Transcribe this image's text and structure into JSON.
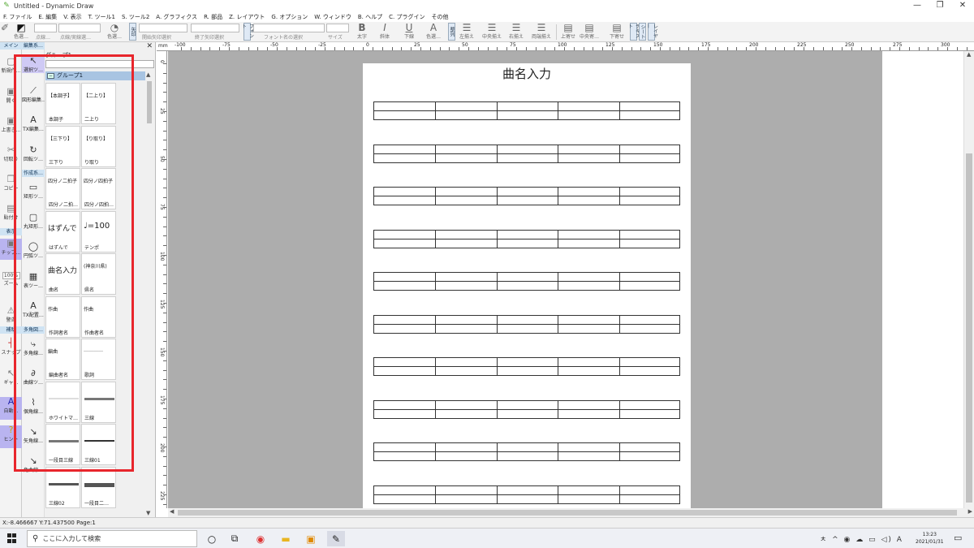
{
  "window": {
    "title": "Untitled - Dynamic Draw",
    "min": "—",
    "max": "❐",
    "close": "✕"
  },
  "menu": [
    "F. ファイル",
    "E. 編集",
    "V. 表示",
    "T. ツール1",
    "S. ツール2",
    "A. グラフィクス",
    "R. 部品",
    "Z. レイアウト",
    "G. オプション",
    "W. ウィンドウ",
    "B. ヘルプ",
    "C. プラグイン",
    "その他"
  ],
  "toolbar": {
    "color_label1": "色選…",
    "linetype_label": "点線…",
    "dash_label": "点線/実線選…",
    "color_label2": "色選…",
    "arrow_tab": "矢印",
    "arrow_start": "開始矢印選択",
    "arrow_end": "終了矢印選択",
    "font_tab": "フォント",
    "font_label": "フォント名の選択",
    "size_label": "サイズ",
    "bold": "太字",
    "italic": "斜体",
    "underline": "下線",
    "fontcolor": "色選…",
    "align_tab": "整列",
    "align_left": "左揃え",
    "align_center": "中央揃え",
    "align_right": "右揃え",
    "align_justify": "両端揃え",
    "valign_top": "上寄せ",
    "valign_middle": "中央寄…",
    "valign_bottom": "下寄せ",
    "text_tab": "テキスト",
    "sheet_tab": "シート",
    "layer_tab": "レイヤー"
  },
  "left_strip": {
    "tab_main": "メイン",
    "new": "新規作…",
    "open": "開く",
    "save": "上書き…",
    "cut": "切取り",
    "copy": "コピー",
    "paste": "貼付け",
    "tab_view": "表示",
    "chip": "チップ…",
    "zoom_value": "100%",
    "zoom": "ズーム",
    "warning": "警告",
    "tab_assist": "補助",
    "snap": "スナップ",
    "grip": "ギャ…",
    "auto": "自動…",
    "hint": "ヒント"
  },
  "tools": {
    "tab_edit": "編集系…",
    "select": "選択ツ…",
    "shape_edit": "図形編集…",
    "tx_edit": "TX編集…",
    "rotate": "回転ツ…",
    "tab_create": "作成系…",
    "rect": "矩形ツ…",
    "roundrect": "丸矩形…",
    "ellipse": "円弧ツ…",
    "table": "表ツー…",
    "tx_place": "TX配置…",
    "tab_polygon": "多角図…",
    "polygon": "多角線…",
    "curve": "曲線ツ…",
    "freeline": "個角線…",
    "arrowline": "矢角線…",
    "corner": "角曲線…"
  },
  "parts": {
    "header_tab": "グループ1",
    "group": "グループ1",
    "items": [
      {
        "preview": "【本調子】",
        "caption": "本調子"
      },
      {
        "preview": "【二上り】",
        "caption": "二上り"
      },
      {
        "preview": "【三下り】",
        "caption": "三下り"
      },
      {
        "preview": "【り取り】",
        "caption": "り取り"
      },
      {
        "preview": "四分ノ二拍子",
        "caption": "四分ノ二拍…"
      },
      {
        "preview": "四分ノ四拍子",
        "caption": "四分ノ四拍…"
      },
      {
        "preview": "はずんで",
        "caption": "はずんで"
      },
      {
        "preview": "♩=100",
        "caption": "テンポ"
      },
      {
        "preview": "曲名入力",
        "caption": "曲名"
      },
      {
        "preview": "(神奈川県)",
        "caption": "県名"
      },
      {
        "preview": "作曲",
        "caption": "作詞者名"
      },
      {
        "preview": "作曲",
        "caption": "作曲者名"
      },
      {
        "preview": "編曲",
        "caption": "編曲者名"
      },
      {
        "preview": "…………",
        "caption": "歌詞"
      },
      {
        "preview": "",
        "caption": "ホワイトマ…"
      },
      {
        "preview": "",
        "caption": "三線"
      },
      {
        "preview": "",
        "caption": "一段目三線"
      },
      {
        "preview": "",
        "caption": "三線01"
      },
      {
        "preview": "",
        "caption": "三線02"
      },
      {
        "preview": "",
        "caption": "一段目二…"
      }
    ]
  },
  "ruler": {
    "unit": "mm",
    "h_labels": [
      "-100",
      "-75",
      "-50",
      "-25",
      "0",
      "25",
      "50",
      "75",
      "100",
      "125",
      "150",
      "175",
      "200",
      "225",
      "250",
      "275",
      "300"
    ],
    "v_labels": [
      "0",
      "25",
      "50",
      "75",
      "100",
      "125",
      "150",
      "175",
      "200",
      "225"
    ]
  },
  "document": {
    "title": "曲名入力",
    "staff_rows": 10
  },
  "status": {
    "text": "X:-8.466667 Y:71.437500 Page:1"
  },
  "taskbar": {
    "search_placeholder": "ここに入力して検索",
    "tray": "ㅊ ^ ◉ ☁ ▭ ◁) A",
    "time": "13:23",
    "date": "2021/01/31"
  },
  "colors": {
    "highlight": "#e8262c",
    "canvas_bg": "#adadad",
    "panel_header": "#a8c4e2",
    "tab_bg": "#cfe3f3",
    "selected_tool": "#b9b4f0"
  }
}
